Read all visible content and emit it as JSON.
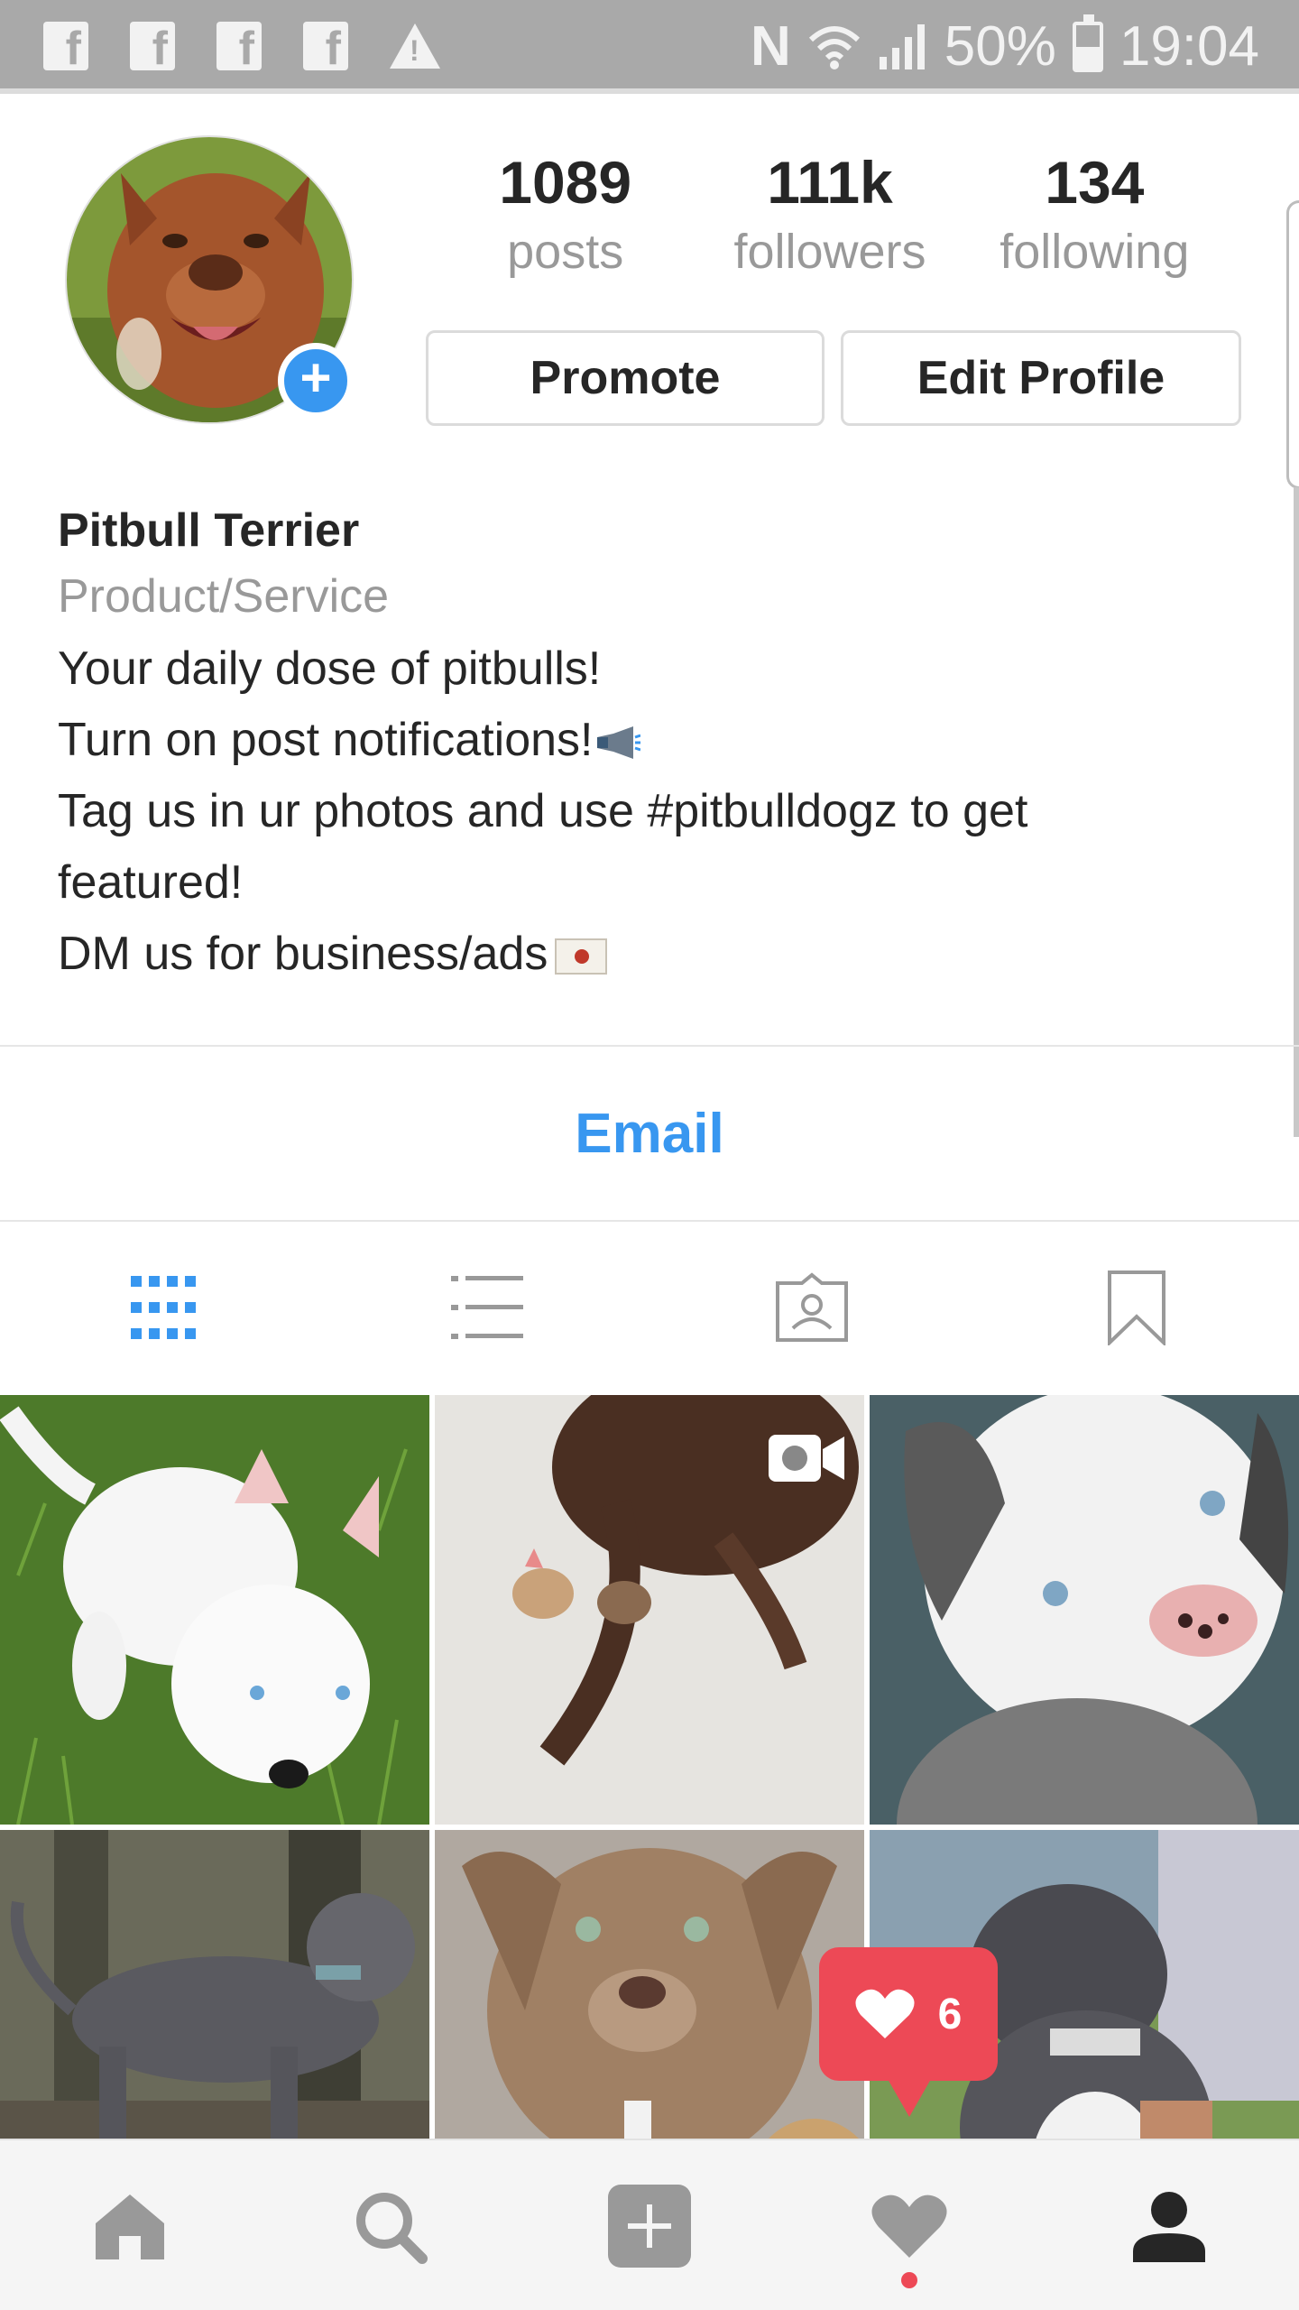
{
  "status_bar": {
    "notification_icons": [
      "facebook-icon",
      "facebook-icon",
      "facebook-icon",
      "facebook-icon",
      "warning-icon"
    ],
    "nfc": "N",
    "battery": "50%",
    "time": "19:04"
  },
  "profile": {
    "avatar": "pitbull-avatar",
    "stats": [
      {
        "value": "1089",
        "label": "posts"
      },
      {
        "value": "111k",
        "label": "followers"
      },
      {
        "value": "134",
        "label": "following"
      }
    ],
    "promote_label": "Promote",
    "edit_label": "Edit Profile"
  },
  "bio": {
    "name": "Pitbull Terrier",
    "category": "Product/Service",
    "lines": [
      "Your daily dose of pitbulls!",
      "Turn on post notifications!",
      "Tag us in ur photos and use #pitbulldogz to get",
      "featured!",
      "DM us for business/ads"
    ]
  },
  "contact": {
    "email_label": "Email"
  },
  "view_tabs": [
    "grid-icon",
    "list-icon",
    "tagged-icon",
    "saved-icon"
  ],
  "notification": {
    "count": "6"
  },
  "bottom_nav": [
    "home-icon",
    "search-icon",
    "add-post-icon",
    "activity-icon",
    "profile-icon"
  ],
  "colors": {
    "accent": "#3897f0",
    "notification": "#ed4956",
    "status_bar": "#a9a9a9"
  }
}
